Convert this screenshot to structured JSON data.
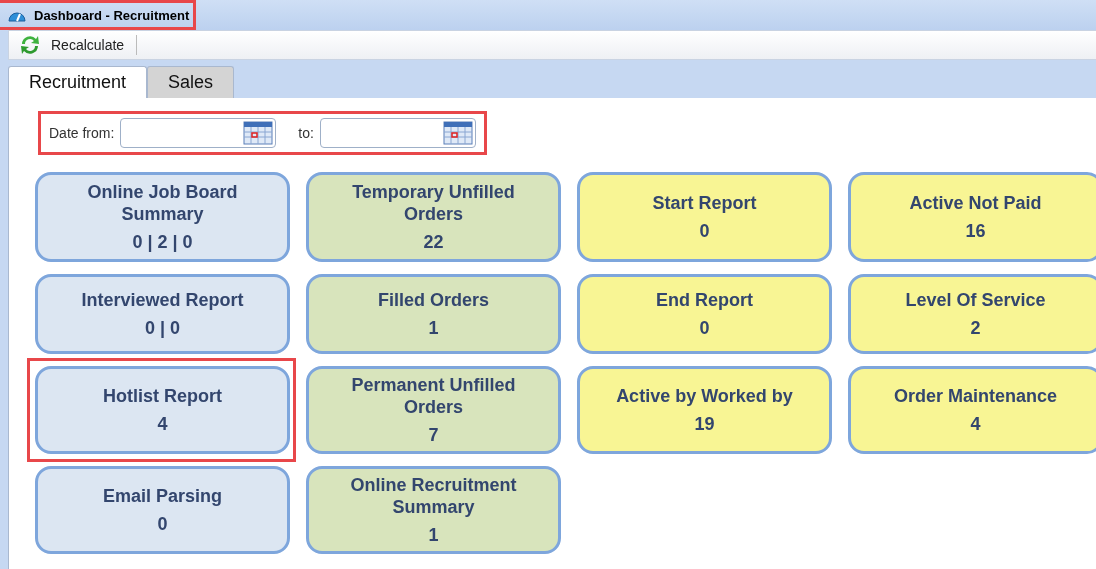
{
  "window": {
    "title": "Dashboard - Recruitment",
    "highlighted": true
  },
  "toolbar": {
    "buttons": [
      {
        "label": "Recalculate"
      }
    ]
  },
  "tabs": [
    {
      "label": "Recruitment",
      "selected": true
    },
    {
      "label": "Sales",
      "selected": false
    }
  ],
  "date_filter": {
    "highlighted": true,
    "from_label": "Date from:",
    "to_label": "to:"
  },
  "tiles": [
    {
      "title": "Online Job Board Summary",
      "value": "0 | 2 | 0",
      "color": "#dce6f2",
      "highlighted": false
    },
    {
      "title": "Temporary Unfilled Orders",
      "value": "22",
      "color": "#d8e4bc",
      "highlighted": false
    },
    {
      "title": "Start Report",
      "value": "0",
      "color": "#f8f594",
      "highlighted": false
    },
    {
      "title": "Active Not Paid",
      "value": "16",
      "color": "#f8f594",
      "highlighted": false
    },
    {
      "title": "Interviewed Report",
      "value": "0 | 0",
      "color": "#dce6f2",
      "highlighted": false
    },
    {
      "title": "Filled Orders",
      "value": "1",
      "color": "#d8e4bc",
      "highlighted": false
    },
    {
      "title": "End Report",
      "value": "0",
      "color": "#f8f594",
      "highlighted": false
    },
    {
      "title": "Level Of Service",
      "value": "2",
      "color": "#f8f594",
      "highlighted": false
    },
    {
      "title": "Hotlist Report",
      "value": "4",
      "color": "#dce6f2",
      "highlighted": true
    },
    {
      "title": "Permanent Unfilled Orders",
      "value": "7",
      "color": "#d8e4bc",
      "highlighted": false
    },
    {
      "title": "Active by Worked by",
      "value": "19",
      "color": "#f8f594",
      "highlighted": false
    },
    {
      "title": "Order Maintenance",
      "value": "4",
      "color": "#f8f594",
      "highlighted": false
    },
    {
      "title": "Email Parsing",
      "value": "0",
      "color": "#dce6f2",
      "highlighted": false
    },
    {
      "title": "Online Recruitment Summary",
      "value": "1",
      "color": "#d8e4bc",
      "highlighted": false
    }
  ]
}
